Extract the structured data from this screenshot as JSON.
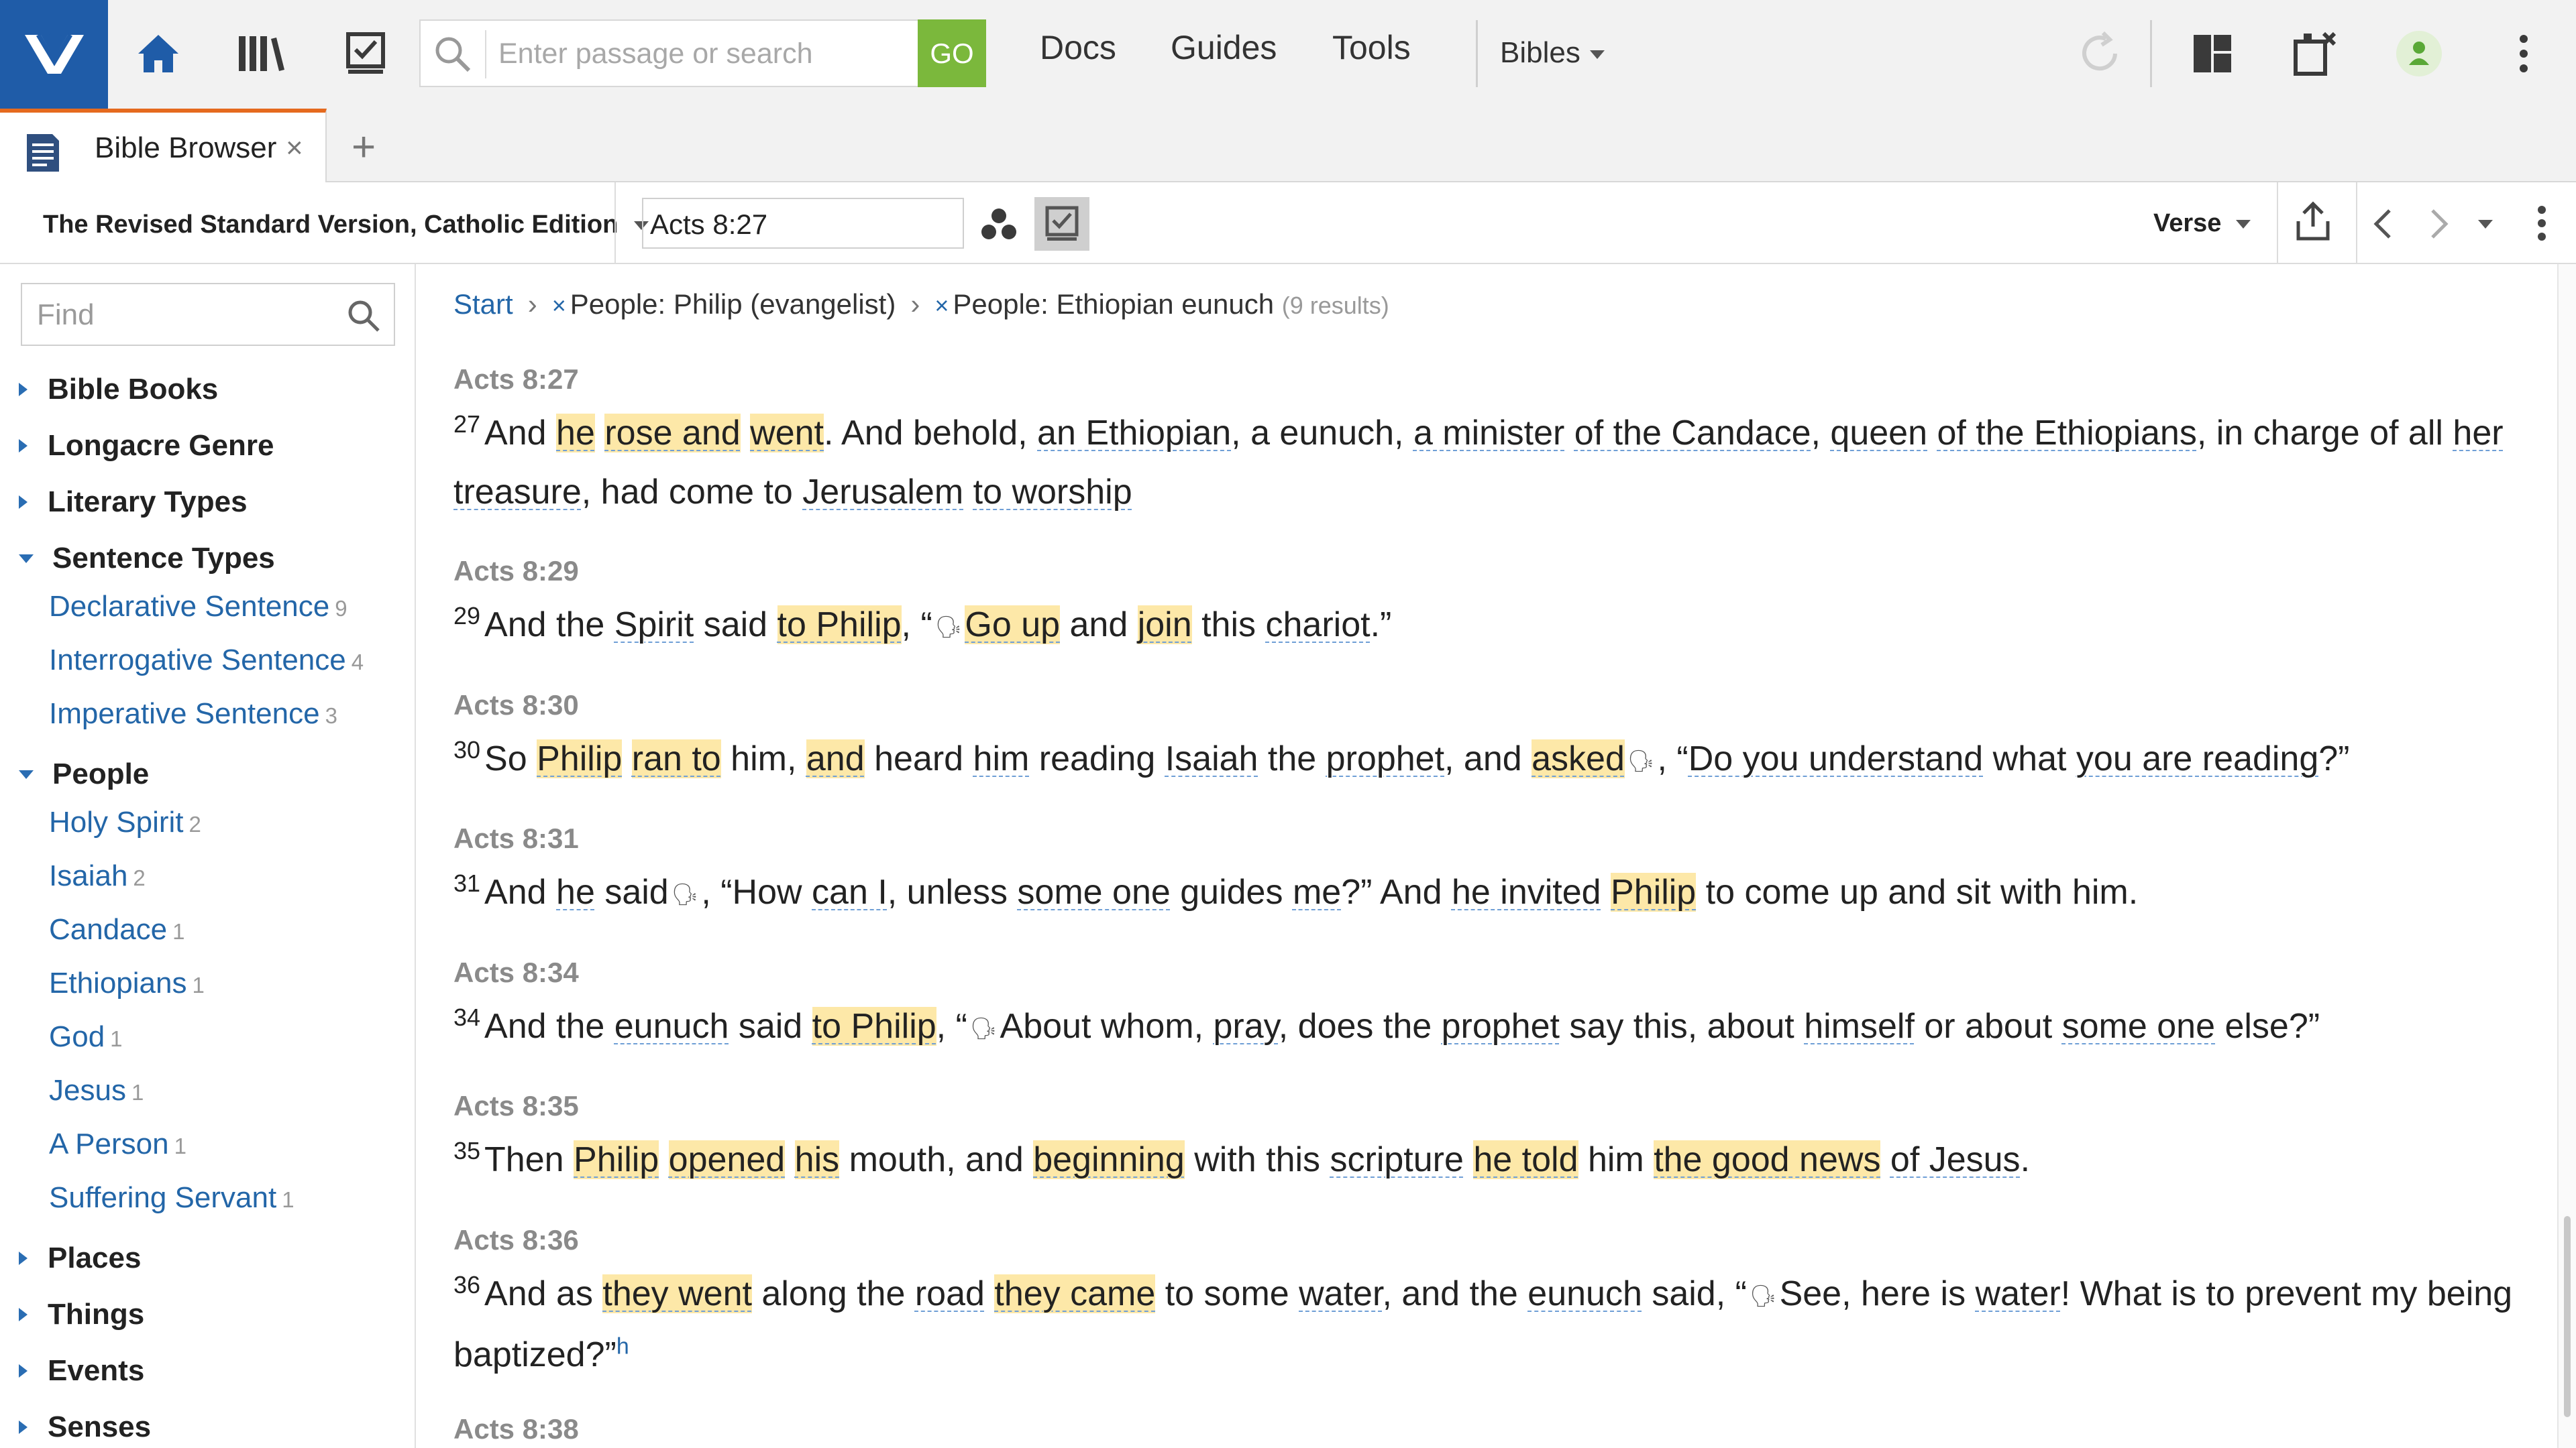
{
  "topbar": {
    "search_placeholder": "Enter passage or search",
    "go_label": "GO",
    "nav": [
      "Docs",
      "Guides",
      "Tools"
    ],
    "bibles_label": "Bibles"
  },
  "tabs": {
    "active_label": "Bible Browser",
    "close_glyph": "×",
    "add_glyph": "+"
  },
  "toolbar": {
    "version": "The Revised Standard Version, Catholic Edition",
    "reference": "Acts 8:27",
    "view_mode": "Verse"
  },
  "sidebar": {
    "find_placeholder": "Find",
    "sections": {
      "bible_books": "Bible Books",
      "longacre": "Longacre Genre",
      "literary": "Literary Types",
      "sentence": "Sentence Types",
      "people": "People",
      "places": "Places",
      "things": "Things",
      "events": "Events",
      "senses": "Senses"
    },
    "sentence_items": [
      {
        "label": "Declarative Sentence",
        "count": "9"
      },
      {
        "label": "Interrogative Sentence",
        "count": "4"
      },
      {
        "label": "Imperative Sentence",
        "count": "3"
      }
    ],
    "people_items": [
      {
        "label": "Holy Spirit",
        "count": "2"
      },
      {
        "label": "Isaiah",
        "count": "2"
      },
      {
        "label": "Candace",
        "count": "1"
      },
      {
        "label": "Ethiopians",
        "count": "1"
      },
      {
        "label": "God",
        "count": "1"
      },
      {
        "label": "Jesus",
        "count": "1"
      },
      {
        "label": "A Person",
        "count": "1"
      },
      {
        "label": "Suffering Servant",
        "count": "1"
      }
    ]
  },
  "breadcrumb": {
    "start": "Start",
    "filter1": "People: Philip (evangelist)",
    "filter2": "People: Ethiopian eunuch",
    "results": "(9 results)"
  },
  "verses": [
    {
      "ref": "Acts 8:27",
      "num": "27"
    },
    {
      "ref": "Acts 8:29",
      "num": "29"
    },
    {
      "ref": "Acts 8:30",
      "num": "30"
    },
    {
      "ref": "Acts 8:31",
      "num": "31"
    },
    {
      "ref": "Acts 8:34",
      "num": "34"
    },
    {
      "ref": "Acts 8:35",
      "num": "35"
    },
    {
      "ref": "Acts 8:36",
      "num": "36"
    },
    {
      "ref": "Acts 8:38"
    }
  ],
  "verse_text": {
    "v27": [
      "And",
      "he",
      "rose and",
      "went",
      ". And behold, ",
      "an Ethiopian",
      ", a eunuch, ",
      "a minister",
      " ",
      "of the Candace",
      ", ",
      "queen",
      " ",
      "of the Ethiopians",
      ", in charge of all ",
      "her treasure",
      ", had come to ",
      "Jerusalem",
      " ",
      "to worship"
    ],
    "v29": [
      "And the ",
      "Spirit",
      " said ",
      "to Philip",
      ", “",
      "Go up",
      " and ",
      "join",
      " this ",
      "chariot",
      ".”"
    ],
    "v30": [
      "So ",
      "Philip",
      " ",
      "ran to",
      " him, ",
      "and",
      " heard ",
      "him",
      " reading ",
      "Isaiah",
      " the ",
      "prophet",
      ", and ",
      "asked",
      ", “",
      "Do you understand",
      " what ",
      "you are reading",
      "?”"
    ],
    "v31": [
      "And ",
      "he",
      " said",
      ", “How ",
      "can I",
      ", unless ",
      "some one",
      " guides ",
      "me",
      "?” And ",
      "he invited",
      " ",
      "Philip",
      " to come up and sit with him."
    ],
    "v34": [
      "And the ",
      "eunuch",
      " said ",
      "to Philip",
      ", “",
      "About whom, ",
      "pray",
      ", does the ",
      "prophet",
      " say this, about ",
      "himself",
      " or about ",
      "some one",
      " else?”"
    ],
    "v35": [
      "Then ",
      "Philip",
      " ",
      "opened",
      " ",
      "his",
      " mouth, and ",
      "beginning",
      " with this ",
      "scripture",
      " ",
      "he told",
      " him ",
      "the good news",
      " ",
      "of Jesus",
      "."
    ],
    "v36": [
      "And as ",
      "they went",
      " along the ",
      "road",
      " ",
      "they came",
      " to some ",
      "water",
      ", and the ",
      "eunuch",
      " said, “",
      "See, here is ",
      "water",
      "! What is to prevent my being baptized?”",
      "h"
    ]
  },
  "icons": {
    "logo": "logos-icon",
    "home": "home-icon",
    "library": "library-icon",
    "tasks": "checklist-icon",
    "sync": "sync-icon",
    "layout": "layout-icon",
    "close_panels": "close-panels-icon",
    "account": "user-icon",
    "more": "kebab-icon",
    "speech": "speech-icon"
  },
  "colors": {
    "brand": "#1f5ca8",
    "go": "#7bb83c",
    "active_tab": "#e56a1e",
    "highlight": "#fde8a8",
    "link": "#2366a8"
  }
}
